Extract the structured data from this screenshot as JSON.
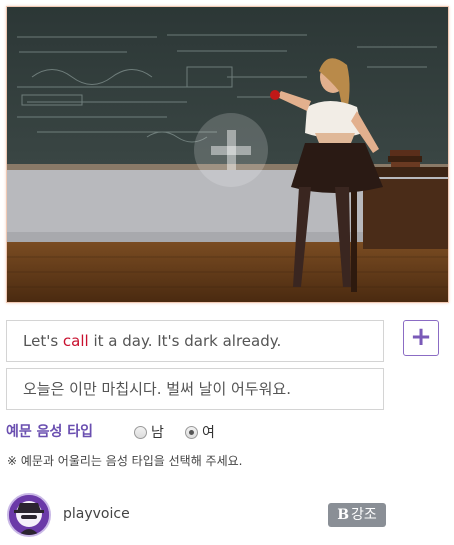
{
  "sentence": {
    "en_before": "Let's ",
    "en_keyword": "call",
    "en_after": " it a day. It's dark already.",
    "ko": "오늘은 이만 마칩시다. 벌써 날이 어두워요."
  },
  "add_button_label": "+",
  "voice_type": {
    "label": "예문 음성 타입",
    "options": [
      "남",
      "여"
    ],
    "selected": "여"
  },
  "note": "※ 예문과 어울리는 음성 타입을 선택해 주세요.",
  "author": {
    "name": "playvoice"
  },
  "emphasis_button": {
    "icon_letter": "B",
    "label": "강조"
  },
  "colors": {
    "keyword": "#c8102e",
    "accent_purple": "#6a4fb0",
    "emphasis_bg": "#8a8f96"
  },
  "icons": {
    "photo_overlay": "plus-icon",
    "avatar": "spy-avatar-icon"
  }
}
